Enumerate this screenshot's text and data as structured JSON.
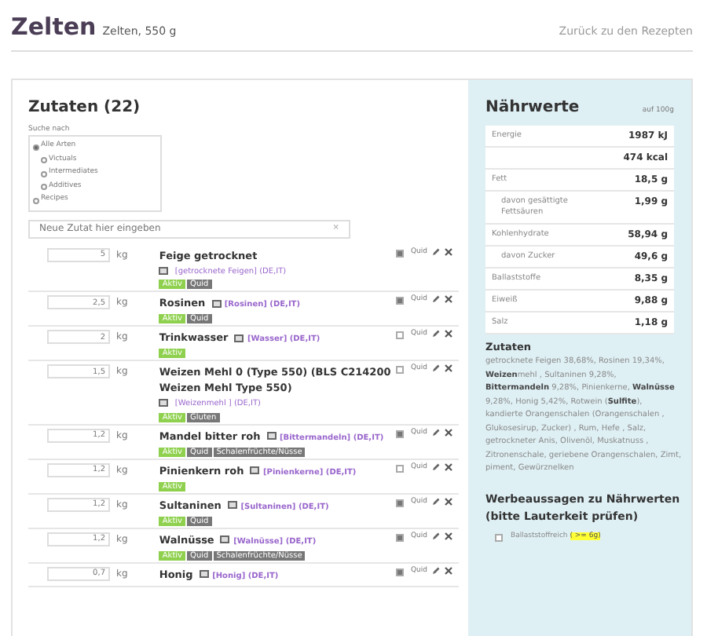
{
  "header": {
    "title": "Zelten",
    "subtitle": "Zelten, 550 g",
    "back_link": "Zurück zu den Rezepten"
  },
  "ingredients": {
    "heading": "Zutaten (22)",
    "search_label": "Suche nach",
    "search_options": [
      {
        "label": "Alle Arten",
        "selected": true,
        "children": [
          {
            "label": "Victuals",
            "selected": false
          },
          {
            "label": "Intermediates",
            "selected": false
          },
          {
            "label": "Additives",
            "selected": false
          }
        ]
      },
      {
        "label": "Recipes",
        "selected": false
      }
    ],
    "new_placeholder": "Neue Zutat hier eingeben",
    "clear": "×",
    "items": [
      {
        "amount": "5",
        "unit": "kg",
        "name": "Feige getrocknet",
        "link": "[getrocknete Feigen] (DE,IT)",
        "link_below": true,
        "badges": [
          {
            "text": "Aktiv",
            "color": "#8fd14f"
          },
          {
            "text": "Quid",
            "color": "#777777"
          }
        ],
        "quid": true,
        "quid_label": "Quid"
      },
      {
        "amount": "2,5",
        "unit": "kg",
        "name": "Rosinen",
        "link": "[Rosinen] (DE,IT)",
        "link_below": false,
        "badges": [
          {
            "text": "Aktiv",
            "color": "#8fd14f"
          },
          {
            "text": "Quid",
            "color": "#777777"
          }
        ],
        "quid": true,
        "quid_label": "Quid"
      },
      {
        "amount": "2",
        "unit": "kg",
        "name": "Trinkwasser",
        "link": "[Wasser] (DE,IT)",
        "link_below": false,
        "badges": [
          {
            "text": "Aktiv",
            "color": "#8fd14f"
          }
        ],
        "quid": false,
        "quid_label": "Quid"
      },
      {
        "amount": "1,5",
        "unit": "kg",
        "name": "Weizen Mehl 0 (Type 550) (BLS C214200 Weizen Mehl Type 550)",
        "link": "[Weizenmehl ] (DE,IT)",
        "link_below": true,
        "badges": [
          {
            "text": "Aktiv",
            "color": "#8fd14f"
          },
          {
            "text": "Gluten",
            "color": "#777777"
          }
        ],
        "quid": false,
        "quid_label": "Quid"
      },
      {
        "amount": "1,2",
        "unit": "kg",
        "name": "Mandel bitter roh",
        "link": "[Bittermandeln] (DE,IT)",
        "link_below": false,
        "badges": [
          {
            "text": "Aktiv",
            "color": "#8fd14f"
          },
          {
            "text": "Quid",
            "color": "#777777"
          },
          {
            "text": "Schalenfrüchte/Nüsse",
            "color": "#777777"
          }
        ],
        "quid": true,
        "quid_label": "Quid"
      },
      {
        "amount": "1,2",
        "unit": "kg",
        "name": "Pinienkern roh",
        "link": "[Pinienkerne] (DE,IT)",
        "link_below": false,
        "badges": [
          {
            "text": "Aktiv",
            "color": "#8fd14f"
          }
        ],
        "quid": false,
        "quid_label": "Quid"
      },
      {
        "amount": "1,2",
        "unit": "kg",
        "name": "Sultaninen",
        "link": "[Sultaninen] (DE,IT)",
        "link_below": false,
        "badges": [
          {
            "text": "Aktiv",
            "color": "#8fd14f"
          },
          {
            "text": "Quid",
            "color": "#777777"
          }
        ],
        "quid": true,
        "quid_label": "Quid"
      },
      {
        "amount": "1,2",
        "unit": "kg",
        "name": "Walnüsse",
        "link": "[Walnüsse] (DE,IT)",
        "link_below": false,
        "badges": [
          {
            "text": "Aktiv",
            "color": "#8fd14f"
          },
          {
            "text": "Quid",
            "color": "#777777"
          },
          {
            "text": "Schalenfrüchte/Nüsse",
            "color": "#777777"
          }
        ],
        "quid": true,
        "quid_label": "Quid"
      },
      {
        "amount": "0,7",
        "unit": "kg",
        "name": "Honig",
        "link": "[Honig] (DE,IT)",
        "link_below": false,
        "quid": true,
        "quid_label": "Quid"
      }
    ]
  },
  "nutrition": {
    "heading": "Nährwerte",
    "per": "auf 100g",
    "rows": [
      {
        "label": "Energie",
        "value": "1987 kJ",
        "sub": false
      },
      {
        "label": "",
        "value": "474 kcal"
      },
      {
        "label": "Fett",
        "value": "18,5 g",
        "sub": false
      },
      {
        "label": "davon gesättigte Fettsäuren",
        "value": "1,99 g",
        "sub": true
      },
      {
        "label": "Kohlenhydrate",
        "value": "58,94 g",
        "sub": false
      },
      {
        "label": "davon Zucker",
        "value": "49,6 g",
        "sub": true
      },
      {
        "label": "Ballaststoffe",
        "value": "8,35 g",
        "sub": false
      },
      {
        "label": "Eiweiß",
        "value": "9,88 g",
        "sub": false
      },
      {
        "label": "Salz",
        "value": "1,18 g",
        "sub": false
      }
    ],
    "ingredients_heading": "Zutaten",
    "ingredients_text": "getrocknete Feigen 38,68%, Rosinen 19,34%, **Weizen**mehl , Sultaninen 9,28%, **Bittermandeln** 9,28%, Pinienkerne, **Walnüsse** 9,28%, Honig 5,42%, Rotwein (**Sulfite**), kandierte Orangenschalen (Orangenschalen , Glukosesirup, Zucker) , Rum, Hefe , Salz, getrockneter Anis, Olivenöl, Muskatnuss , Zitronenschale, geriebene Orangenschalen, Zimt, piment, Gewürznelken",
    "claims_heading": "Werbeaussagen zu Nährwerten (bitte Lauterkeit prüfen)",
    "claims": [
      {
        "label": "Ballaststoffreich",
        "hint": "( >= 6g)",
        "checked": false
      }
    ]
  }
}
